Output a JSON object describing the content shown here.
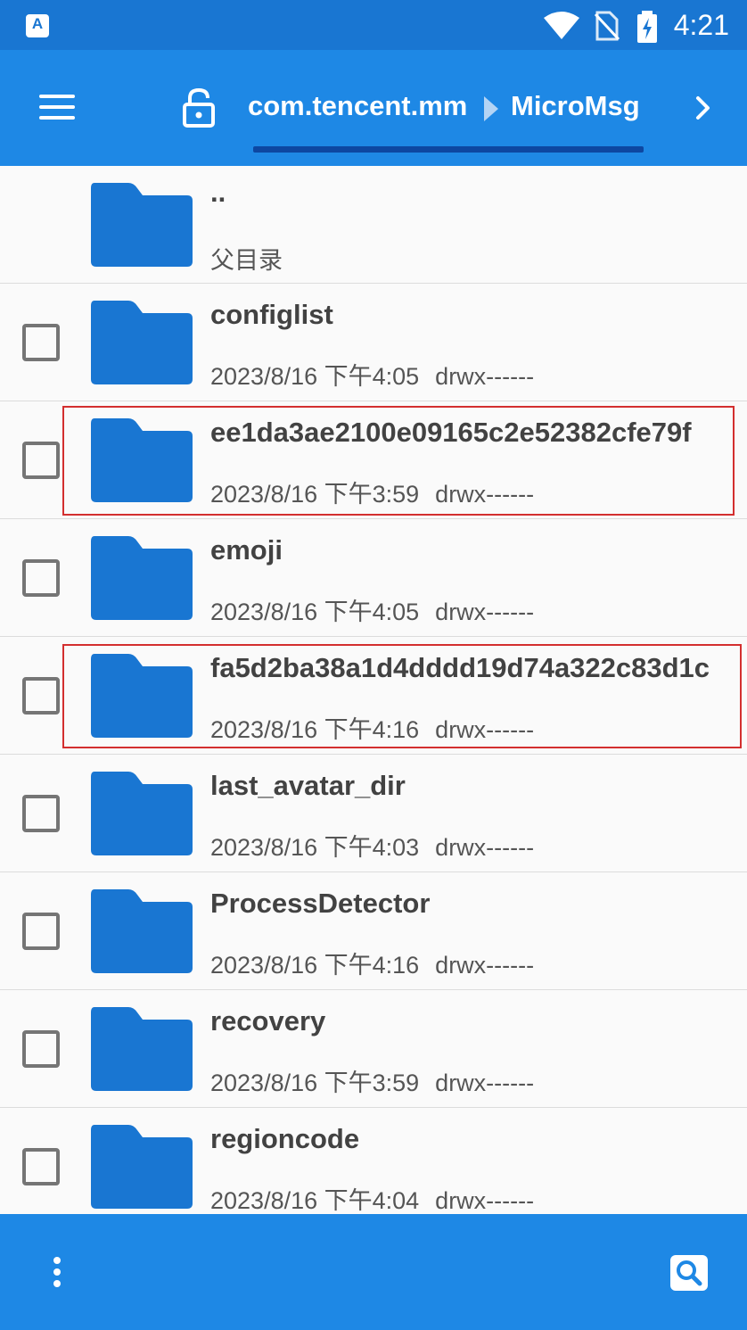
{
  "status_bar": {
    "time": "4:21",
    "app_icon_letter": "A",
    "icons": [
      "wifi-icon",
      "no-sim-icon",
      "battery-charging-icon"
    ]
  },
  "app_bar": {
    "menu_icon": "hamburger-menu-icon",
    "lock_icon": "unlock-icon",
    "breadcrumb": [
      "com.tencent.mm",
      "MicroMsg"
    ],
    "next_icon": "chevron-right-icon"
  },
  "parent_entry": {
    "name": "..",
    "description": "父目录"
  },
  "files": [
    {
      "name": "configlist",
      "date": "2023/8/16 下午4:05",
      "perm": "drwx------",
      "highlighted": false
    },
    {
      "name": "ee1da3ae2100e09165c2e52382cfe79f",
      "date": "2023/8/16 下午3:59",
      "perm": "drwx------",
      "highlighted": true
    },
    {
      "name": "emoji",
      "date": "2023/8/16 下午4:05",
      "perm": "drwx------",
      "highlighted": false
    },
    {
      "name": "fa5d2ba38a1d4dddd19d74a322c83d1c",
      "date": "2023/8/16 下午4:16",
      "perm": "drwx------",
      "highlighted": true
    },
    {
      "name": "last_avatar_dir",
      "date": "2023/8/16 下午4:03",
      "perm": "drwx------",
      "highlighted": false
    },
    {
      "name": "ProcessDetector",
      "date": "2023/8/16 下午4:16",
      "perm": "drwx------",
      "highlighted": false
    },
    {
      "name": "recovery",
      "date": "2023/8/16 下午3:59",
      "perm": "drwx------",
      "highlighted": false
    },
    {
      "name": "regioncode",
      "date": "2023/8/16 下午4:04",
      "perm": "drwx------",
      "highlighted": false
    }
  ],
  "bottom_bar": {
    "more_icon": "more-vert-icon",
    "search_icon": "search-icon"
  },
  "colors": {
    "status_bar": "#1976d2",
    "app_bar": "#1e88e5",
    "folder": "#1976d2",
    "highlight": "#d32f2f"
  }
}
